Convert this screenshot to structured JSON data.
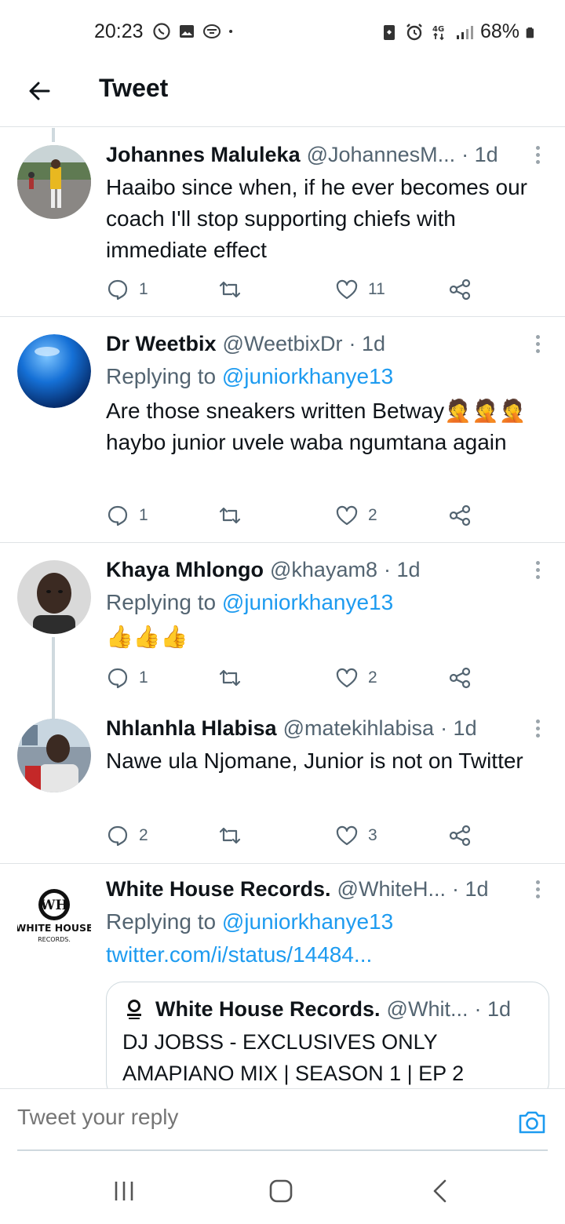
{
  "status_bar": {
    "time": "20:23",
    "battery": "68%",
    "network": "4G"
  },
  "header": {
    "title": "Tweet"
  },
  "tweets": [
    {
      "name": "Johannes Maluleka",
      "handle": "@JohannesM...",
      "time": "· 1d",
      "text": "Haaibo since when, if he ever becomes our coach I'll stop supporting chiefs with immediate effect",
      "replies": "1",
      "retweets": "",
      "likes": "11"
    },
    {
      "name": "Dr Weetbix",
      "handle": "@WeetbixDr",
      "time": "· 1d",
      "replying_label": "Replying to",
      "replying_handle": "@juniorkhanye13",
      "text": "Are those sneakers written Betway🤦🤦🤦haybo junior uvele waba ngumtana again",
      "replies": "1",
      "retweets": "",
      "likes": "2"
    },
    {
      "name": "Khaya Mhlongo",
      "handle": "@khayam8",
      "time": "· 1d",
      "replying_label": "Replying to",
      "replying_handle": "@juniorkhanye13",
      "text": "👍👍👍",
      "replies": "1",
      "retweets": "",
      "likes": "2"
    },
    {
      "name": "Nhlanhla Hlabisa",
      "handle": "@matekihlabisa",
      "time": "· 1d",
      "text": "Nawe ula Njomane, Junior is not on Twitter",
      "replies": "2",
      "retweets": "",
      "likes": "3"
    },
    {
      "name": "White House Records.",
      "handle": "@WhiteH...",
      "time": "· 1d",
      "replying_label": "Replying to",
      "replying_handle": "@juniorkhanye13",
      "link": "twitter.com/i/status/14484...",
      "avatar_logo_text": "WH",
      "avatar_brand": "WHITE HOUSE",
      "avatar_sub": "RECORDS.",
      "quote": {
        "name": "White House Records.",
        "handle": "@Whit...",
        "time": "· 1d",
        "text": "DJ JOBSS - EXCLUSIVES ONLY AMAPIANO MIX | SEASON 1 | EP 2"
      }
    }
  ],
  "composer": {
    "placeholder": "Tweet your reply"
  },
  "colors": {
    "accent": "#1d9bf0",
    "muted": "#536471",
    "divider": "#dfe3e6"
  },
  "icons": [
    "back-arrow-icon",
    "more-vertical-icon",
    "reply-icon",
    "retweet-icon",
    "like-icon",
    "share-icon",
    "camera-icon",
    "recents-icon",
    "home-icon",
    "back-icon"
  ]
}
